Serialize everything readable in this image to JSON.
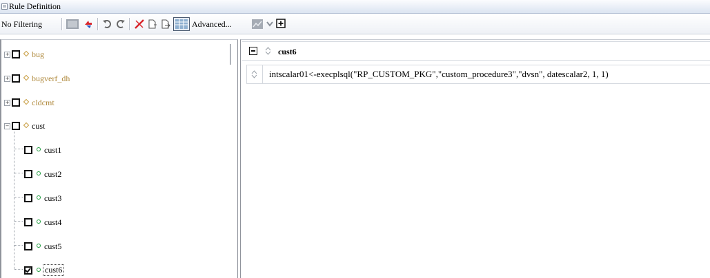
{
  "window": {
    "title": "Rule Definition"
  },
  "toolbar": {
    "filter_label": "No Filtering",
    "advanced_label": "Advanced...",
    "icons": [
      "grid-icon",
      "swap-icon",
      "undo-icon",
      "redo-icon",
      "delete-icon",
      "insert-before-icon",
      "insert-after-icon",
      "table-view-icon",
      "chart-icon",
      "chevron-down-icon",
      "add-icon"
    ]
  },
  "tree": {
    "items": [
      {
        "label": "bug",
        "kind": "function",
        "expanded": false
      },
      {
        "label": "bugverf_dh",
        "kind": "function",
        "expanded": false
      },
      {
        "label": "cldcmt",
        "kind": "function",
        "expanded": false
      },
      {
        "label": "cust",
        "kind": "function",
        "expanded": true
      },
      {
        "label": "cust1",
        "kind": "rule",
        "checked": false
      },
      {
        "label": "cust2",
        "kind": "rule",
        "checked": false
      },
      {
        "label": "cust3",
        "kind": "rule",
        "checked": false
      },
      {
        "label": "cust4",
        "kind": "rule",
        "checked": false
      },
      {
        "label": "cust5",
        "kind": "rule",
        "checked": false
      },
      {
        "label": "cust6",
        "kind": "rule",
        "checked": true
      }
    ]
  },
  "rule": {
    "name": "cust6",
    "statement": "intscalar01<-execplsql(\"RP_CUSTOM_PKG\",\"custom_procedure3\",\"dvsn\", datescalar2, 1, 1)"
  },
  "colors": {
    "function_label": "#b08a3e",
    "rule_dot": "#1f9c3e",
    "titlebar": "#dbe4f1"
  }
}
